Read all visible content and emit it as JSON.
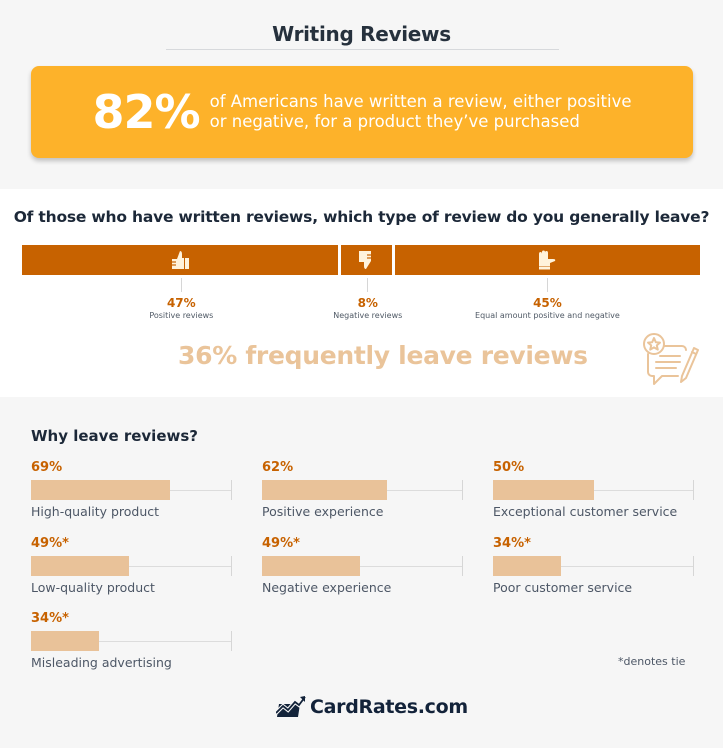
{
  "title": "Writing Reviews",
  "hero": {
    "stat": "82%",
    "text_line1": "of Americans have written a review, either positive",
    "text_line2": "or negative, for a product they’ve purchased",
    "color": "#fdb22a"
  },
  "question": "Of those who have written reviews, which type of review do you generally leave?",
  "frequent": {
    "text": "36% frequently leave reviews",
    "icon": "review-speech-bubble-icon"
  },
  "why_title": "Why leave reviews?",
  "footnote": "*denotes tie",
  "logo": {
    "text": "CardRates.com",
    "icon": "chart-card-logo-icon"
  },
  "colors": {
    "accent": "#c76200",
    "bar_fill": "#e9c299",
    "freq_text": "#eac49a",
    "dark": "#1c2838"
  },
  "chart_data": [
    {
      "type": "bar",
      "orientation": "horizontal-stacked",
      "title": "Of those who have written reviews, which type of review do you generally leave?",
      "categories": [
        "Positive reviews",
        "Negative reviews",
        "Equal amount positive and negative"
      ],
      "values": [
        47,
        8,
        45
      ],
      "value_labels": [
        "47%",
        "8%",
        "45%"
      ],
      "icons": [
        "thumbs-up-icon",
        "thumbs-down-icon",
        "hand-so-so-icon"
      ],
      "unit": "%"
    },
    {
      "type": "bar",
      "orientation": "horizontal",
      "title": "Why leave reviews?",
      "xlim": [
        0,
        100
      ],
      "unit": "%",
      "categories": [
        "High-quality product",
        "Positive experience",
        "Exceptional customer service",
        "Low-quality product",
        "Negative experience",
        "Poor customer service",
        "Misleading advertising"
      ],
      "values": [
        69,
        62,
        50,
        49,
        49,
        34,
        34
      ],
      "value_labels": [
        "69%",
        "62%",
        "50%",
        "49%*",
        "49%*",
        "34%*",
        "34%*"
      ],
      "annotation": "*denotes tie"
    }
  ]
}
